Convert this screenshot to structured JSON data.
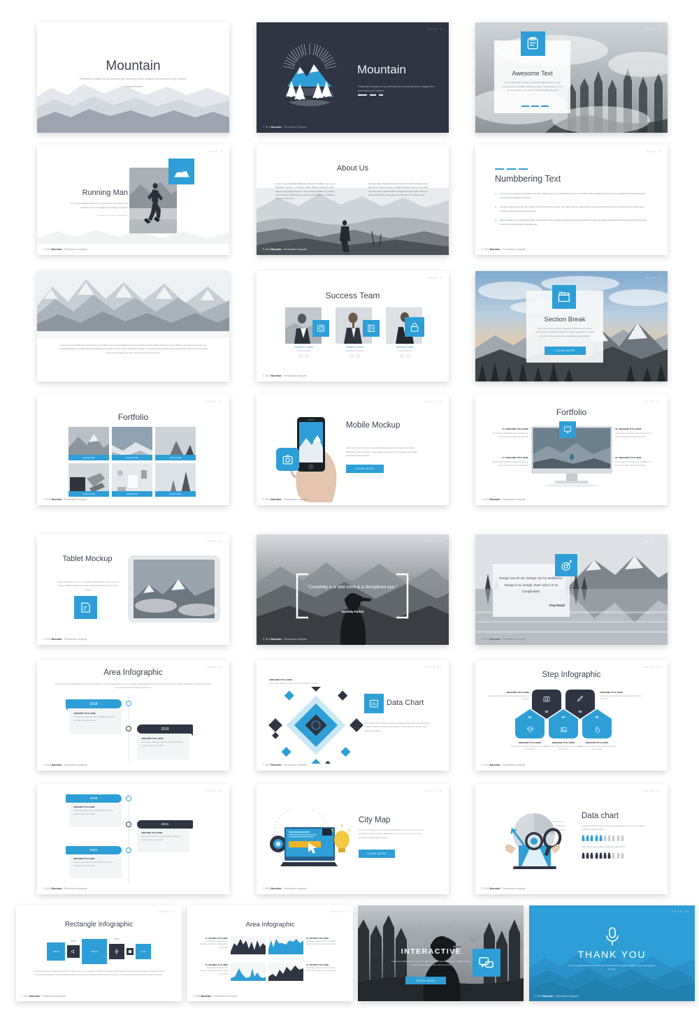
{
  "brand": {
    "name": "Mountain",
    "accent": "#2e9fd6",
    "dark": "#2f3542",
    "footer": "© 2018 Mountain - Presentation template"
  },
  "common": {
    "pager": "PAGE",
    "learn_more": "LEARN MORE",
    "awesome_title": "AWESOME TITLE HERE",
    "filler_body": "Far far away, behind the word mountains, far from the countries, there live the blind",
    "lorem_short": "Lorem ipsum dolor sit amet, consectetur adipiscing elit, sed do eiusmod tempor incididunt ut labore et dolore magna aliqua. Ut enim ad minim veniam, quis nostrud exercitation ullamco laboris"
  },
  "slides": [
    {
      "n": 1,
      "name": "cover-light",
      "title": "Mountain",
      "subtitle": "Presentation template for your personal and commercial needs, designed and presented by Api Typeface"
    },
    {
      "n": 2,
      "name": "cover-dark",
      "title": "Mountain",
      "subtitle": "Presentation template for your personal and commercial needs, designed and presented by Api Typeface",
      "pager": "PAGE 2"
    },
    {
      "n": 3,
      "name": "awesome-text",
      "title": "Awesome Text",
      "body": "Lorem ipsum dolor sit amet, consectetur adipiscing elit, sed do eiusmod tempor incididunt ut labore et dolore magna aliqua. Ut enim ad minim veniam, quis nostrud exercitation ullamco laboris",
      "icon": "clipboard-icon",
      "pager": "PAGE 3"
    },
    {
      "n": 4,
      "name": "running-man",
      "title": "Running Man",
      "body": "It is a long established fact that a reader will be distracted by the readable content of a page when looking at its layout.",
      "icon": "mountain-icon",
      "pager": "PAGE 4"
    },
    {
      "n": 5,
      "name": "about-us",
      "title": "About Us",
      "col_left": "In enim a arcu imperdiet malesuada. Fusce arcu. Nullam at arcu a est sollicitudin euismod. In convallis. Nullam dapibus fermentum ipsum. Aliquam erat volutpat. Excepteur sint occaecat cupidatat non proident, sunt in culpa qui officia deserunt mollit anim id est laborum. Vestibulum fermentum tortor id mi.",
      "col_right": "Nullo quis diam. Pellentesque ipsum. Aliquam id dolor. Vivamus luctus egestas leo. Etiam quis quam. Curabitur bibendum justo non orci. Duis aute irure dolor in reprehenderit in voluptate velit esse cillum dolore eu fugiat nulla pariatur. Suspendisse nisl. Duis ante orci, molestie vitae.",
      "pager": "PAGE 5"
    },
    {
      "n": 6,
      "name": "numbering-text",
      "title": "Numbbering Text",
      "items": [
        "In enim a arcu imperdiet malesuada. Fusce arcu. Nullam at arcu a est sollicitudin euismod. In convallis. Nullam dapibus fermentum ipsum. Aliquam erat volutpat. Excepteur sint occaecat cupidatat non proident",
        "Maecenas aliquet accumsan leo. Aliquam id dolor. Nam libero tempore, cum soluta nobis est eligendi optio cumque nihil impedit quo minus id quod maxime placeat facere possimus, omnis voluptas assumenda est.",
        "Etiam egestas orci a erat Nulla quis diam. Pellentesque ipsum. Aliquam id dolor. Vivamus luctus egestas leo. Etiam quis quam. Curabitur bibendum justo non orci. Duis aute irure dolor in reprehenderit in voluptate velit"
      ],
      "pager": "PAGE 6"
    },
    {
      "n": 7,
      "name": "full-bleed-snow",
      "body": "In enim a arcu imperdiet malesuada. Fusce arcu. Nullam at arcu a est sollicitudin euismod. In convallis. Nullam dapibus fermentum ipsum. Aliquam erat volutpat. Excepteur sint occaecat cupidatat non proident Maecenas aliquet accumsan leo. Aliquam id dolor. Nam libero tempore, cum soluta nobis est eligendi optio cumque nihil impedit quo minus id quod maxime placeat facere possimus, omnis voluptas assumenda est."
    },
    {
      "n": 8,
      "name": "success-team",
      "title": "Success Team",
      "members": [
        {
          "name": "Charles R. Smith",
          "role": "General Manager",
          "icon": "instagram-icon"
        },
        {
          "name": "Dadiun R Smith",
          "role": "Chief Executive Officer",
          "icon": "book-icon"
        },
        {
          "name": "Brennan Smith",
          "role": "Creative Director",
          "icon": "lock-icon"
        }
      ],
      "pager": "PAGE 8"
    },
    {
      "n": 9,
      "name": "section-break",
      "title": "Section Break",
      "body": "Lorem ipsum dolor sit amet, consectetur adipiscing elit, sed do eiusmod tempor incididunt ut labore et dolore magna aliqua. Ut enim ad minim veniam, quis nostrud exercitation ullamco laboris",
      "button": "LEARN MORE",
      "icon": "clapperboard-icon",
      "pager": "PAGE 9"
    },
    {
      "n": 10,
      "name": "portfolio-grid",
      "title": "Fortfolio",
      "caption": "Awesome Title",
      "items": 6,
      "pager": "PAGE 10"
    },
    {
      "n": 11,
      "name": "mobile-mockup",
      "title": "Mobile Mockup",
      "body": "Lorem ipsum dolor sit amet, consectetur adipiscing elit, sed do eiusmod tempor incididunt ut labore et dolore magna aliqua. Ut enim ad minim veniam, quis nostrud exercitation ullamco laboris",
      "button": "LEARN MORE",
      "icon": "camera-icon",
      "pager": "PAGE 11"
    },
    {
      "n": 12,
      "name": "portfolio-monitor",
      "title": "Fortfolio",
      "icon": "monitor-icon",
      "features": [
        {
          "num": "01.",
          "title": "AWESOME TITLE HERE",
          "body": "Far far away, behind the word mountains, far from the countries, there live the blind"
        },
        {
          "num": "02.",
          "title": "AWESOME TITLE HERE",
          "body": "Far far away, behind the word mountains, far from the countries, there live the blind"
        },
        {
          "num": "03.",
          "title": "AWESOME TITLE HERE",
          "body": "Far far away, behind the word mountains, far from the countries, there live the blind"
        },
        {
          "num": "04.",
          "title": "AWESOME TITLE HERE",
          "body": "Far far away, behind the word mountains, far from the countries, there live the blind"
        }
      ],
      "pager": "PAGE 12"
    },
    {
      "n": 13,
      "name": "tablet-mockup",
      "title": "Tablet Mockup",
      "body": "Lorem ipsum dolor sit amet, consectetur adipiscing elit, sed do eiusmod tempor incididunt ut labore et dolore magna aliqua. Ut enim ad minim veniam.",
      "icon": "edit-icon",
      "pager": "PAGE 13"
    },
    {
      "n": 14,
      "name": "quote-dorothy",
      "quote": "\"Creativity is a wild mind & a disciplined eye.\"",
      "author": "-Dorothy Parker",
      "pager": "PAGE 14"
    },
    {
      "n": 15,
      "name": "quote-paul",
      "quote": "Design can be art. Design can be aesthetics. Design is so simple, that's why it is so complicated.",
      "author": "-Paul Rand",
      "icon": "target-icon",
      "pager": "PAGE 15"
    },
    {
      "n": 16,
      "name": "area-infographic-timeline-a",
      "title": "Area Infographic",
      "body": "In enim a arcu imperdiet malesuada. Fusce arcu. Nullam at arcu a est sollicitudin euismod. In convallis. Nullam dapibus fermentum ipsum. Aliquam erat volutpat. Excepteur sint occaecat cupidatat non proident Maecenas aliquet accumsan leo.",
      "steps": [
        {
          "year": "2018",
          "title": "AWESOME TITLE HERE",
          "body": "Far far away, behind the word mountains, far from the countries, there live the blind",
          "color": "blue"
        },
        {
          "year": "2019",
          "title": "AWESOME TITLE HERE",
          "body": "Far far away, behind the word mountains, far from the countries, there live the blind",
          "color": "navy"
        }
      ],
      "pager": "PAGE 16"
    },
    {
      "n": 17,
      "name": "data-chart-diamond",
      "title": "Data Chart",
      "head": "AWESOME TITLE HERE",
      "head_body": "Far far away, behind the word mountains, far from the countries",
      "body": "Lorem ipsum dolor sit amet, consectetur adipiscing elit, sed do eiusmod tempor incididunt ut labore et dolore magna aliqua. Ut enim ad minim veniam, quis nostrud exercitation",
      "icon": "chart-icon",
      "pager": "PAGE 17"
    },
    {
      "n": 18,
      "name": "step-infographic",
      "title": "Step Infographic",
      "steps": [
        {
          "num": "01",
          "title": "AWESOME TITLE HERE",
          "body": "Far far away, behind the word mountains, far from the countries",
          "icon": "diamond-icon",
          "color": "blue"
        },
        {
          "num": "02",
          "title": "AWESOME TITLE HERE",
          "body": "Far far away, behind the word mountains, far from the countries",
          "icon": "camera-icon",
          "color": "navy"
        },
        {
          "num": "03",
          "title": "AWESOME TITLE HERE",
          "body": "Far far away, behind the word mountains, far from the countries",
          "icon": "image-icon",
          "color": "blue"
        },
        {
          "num": "04",
          "title": "AWESOME TITLE HERE",
          "body": "Far far away, behind the word mountains, far from the countries",
          "icon": "rocket-icon",
          "color": "navy"
        },
        {
          "num": "05",
          "title": "AWESOME TITLE HERE",
          "body": "Far far away, behind the word mountains, far from the countries",
          "icon": "hand-icon",
          "color": "blue"
        }
      ],
      "pager": "PAGE 18"
    },
    {
      "n": 19,
      "name": "area-infographic-timeline-b",
      "steps": [
        {
          "year": "2020",
          "title": "AWESOME TITLE HERE",
          "body": "Far far away, behind the word mountains, far from the countries, there live the blind",
          "color": "blue"
        },
        {
          "year": "2021",
          "title": "AWESOME TITLE HERE",
          "body": "Far far away, behind the word mountains, far from the countries, there live the blind",
          "color": "navy"
        },
        {
          "year": "2022",
          "title": "AWESOME TITLE HERE",
          "body": "Far far away, behind the word mountains, far from the countries, there live the blind",
          "color": "blue"
        }
      ],
      "pager": "PAGE 19"
    },
    {
      "n": 20,
      "name": "city-map",
      "title": "City Map",
      "body": "Lorem ipsum dolor sit amet, consectetur adipiscing elit, sed do eiusmod tempor incididunt ut labore et dolore magna aliqua. Ut enim ad minim veniam, quis nostrud exercitation ullamco laboris",
      "button": "LEARN MORE",
      "pager": "PAGE 20"
    },
    {
      "n": 21,
      "name": "data-chart-people",
      "title": "Data chart",
      "body1": "Lorem ipsum dolor sit amet, consectetur adipiscing elit, sed do eiusmod tempor incididunt ut labore et dolore",
      "body2": "Lorem ipsum dolor sit amet, consectetur adipiscing elit",
      "pager": "PAGE 21"
    },
    {
      "n": 22,
      "name": "rectangle-infographic",
      "title": "Rectangle Infographic",
      "values": [
        "130.34",
        "60.30",
        "250.21",
        "95.05",
        "75.26"
      ],
      "body": "In enim a arcu imperdiet malesuada. Fusce arcu. Nullam at arcu a est sollicitudin euismod. In convallis. Nullam dapibus fermentum ipsum. Aliquam erat volutpat. Excepteur sint occaecat cupidatat non proident Maecenas aliquet accumsan leo. Aliquam id dolor. Nam libero tempore, cum soluta nobis est eligendi optio cumque nihil impedit.",
      "pager": "PAGE 22"
    },
    {
      "n": 23,
      "name": "area-infographic-charts",
      "title": "Area Infographic",
      "blocks": [
        {
          "num": "01.",
          "title": "AMAZING TITLE HERE",
          "body": "Far far away, behind the word mountains, far from the countries, there live the blind",
          "color": "navy"
        },
        {
          "num": "02.",
          "title": "AMAZING TITLE HERE",
          "body": "Far far away, behind the word mountains, far from the countries, there live the blind",
          "color": "blue"
        },
        {
          "num": "03.",
          "title": "AMAZING TITLE HERE",
          "body": "Far far away, behind the word mountains, far from the countries, there live the blind",
          "color": "blue"
        },
        {
          "num": "04.",
          "title": "AMAZING TITLE HERE",
          "body": "Far far away, behind the word mountains, far from the countries, there live the blind",
          "color": "navy"
        }
      ],
      "pager": "PAGE 23"
    },
    {
      "n": 24,
      "name": "interactive",
      "title": "INTERACTIVE",
      "body": "Lorem ipsum dolor sit amet, consectetur adipiscing elit, sed do eiusmod tempor incididunt ut labore et dolore magna aliqua. Ut enim ad minim veniam",
      "button": "LEARN MORE",
      "icon": "chat-icon"
    },
    {
      "n": 25,
      "name": "thank-you",
      "title": "THANK YOU",
      "body": "It is a long established fact that a reader will be distracted by the readable content of a page when looking at its layout.",
      "icon": "microphone-icon",
      "pager": "PAGE 25"
    }
  ],
  "chart_data": {
    "type": "bar",
    "title": "Rectangle Infographic",
    "categories": [
      "1",
      "2",
      "3",
      "4",
      "5"
    ],
    "values": [
      130.34,
      60.3,
      250.21,
      95.05,
      75.26
    ],
    "xlabel": "",
    "ylabel": "",
    "colors": [
      "#2e9fd6",
      "#2f3542",
      "#2e9fd6",
      "#2f3542",
      "#2e9fd6"
    ]
  }
}
